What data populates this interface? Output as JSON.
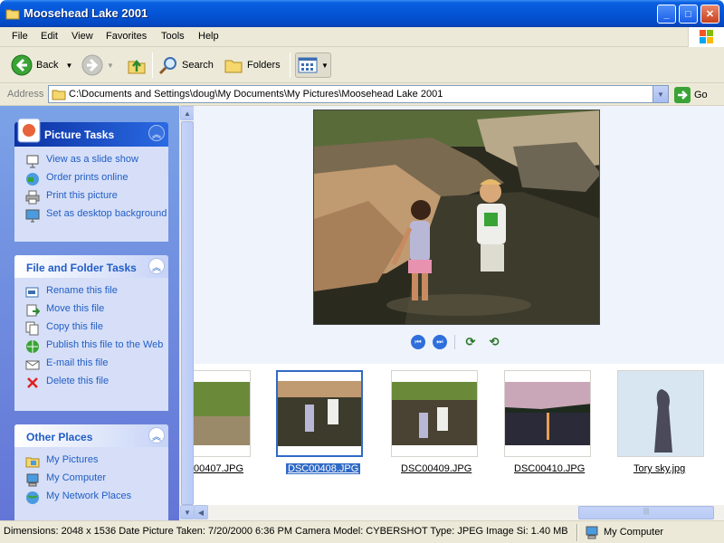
{
  "window": {
    "title": "Moosehead Lake 2001"
  },
  "menu": [
    "File",
    "Edit",
    "View",
    "Favorites",
    "Tools",
    "Help"
  ],
  "toolbar": {
    "back": "Back",
    "search": "Search",
    "folders": "Folders"
  },
  "address": {
    "label": "Address",
    "path": "C:\\Documents and Settings\\doug\\My Documents\\My Pictures\\Moosehead Lake 2001",
    "go": "Go"
  },
  "panels": {
    "picture_tasks": {
      "title": "Picture Tasks",
      "items": [
        "View as a slide show",
        "Order prints online",
        "Print this picture",
        "Set as desktop background"
      ]
    },
    "file_folder_tasks": {
      "title": "File and Folder Tasks",
      "items": [
        "Rename this file",
        "Move this file",
        "Copy this file",
        "Publish this file to the Web",
        "E-mail this file",
        "Delete this file"
      ]
    },
    "other_places": {
      "title": "Other Places",
      "items": [
        "My Pictures",
        "My Computer",
        "My Network Places"
      ]
    }
  },
  "thumbnails": [
    {
      "label": "00407.JPG",
      "selected": false
    },
    {
      "label": "DSC00408.JPG",
      "selected": true
    },
    {
      "label": "DSC00409.JPG",
      "selected": false
    },
    {
      "label": "DSC00410.JPG",
      "selected": false
    },
    {
      "label": "Tory sky.jpg",
      "selected": false
    }
  ],
  "status": {
    "text": "Dimensions: 2048 x 1536 Date Picture Taken: 7/20/2000 6:36 PM Camera Model: CYBERSHOT Type: JPEG Image Si: 1.40 MB",
    "location": "My Computer"
  },
  "colors": {
    "title_blue": "#0455d6",
    "link_blue": "#215dc6",
    "selection": "#316ac5"
  }
}
